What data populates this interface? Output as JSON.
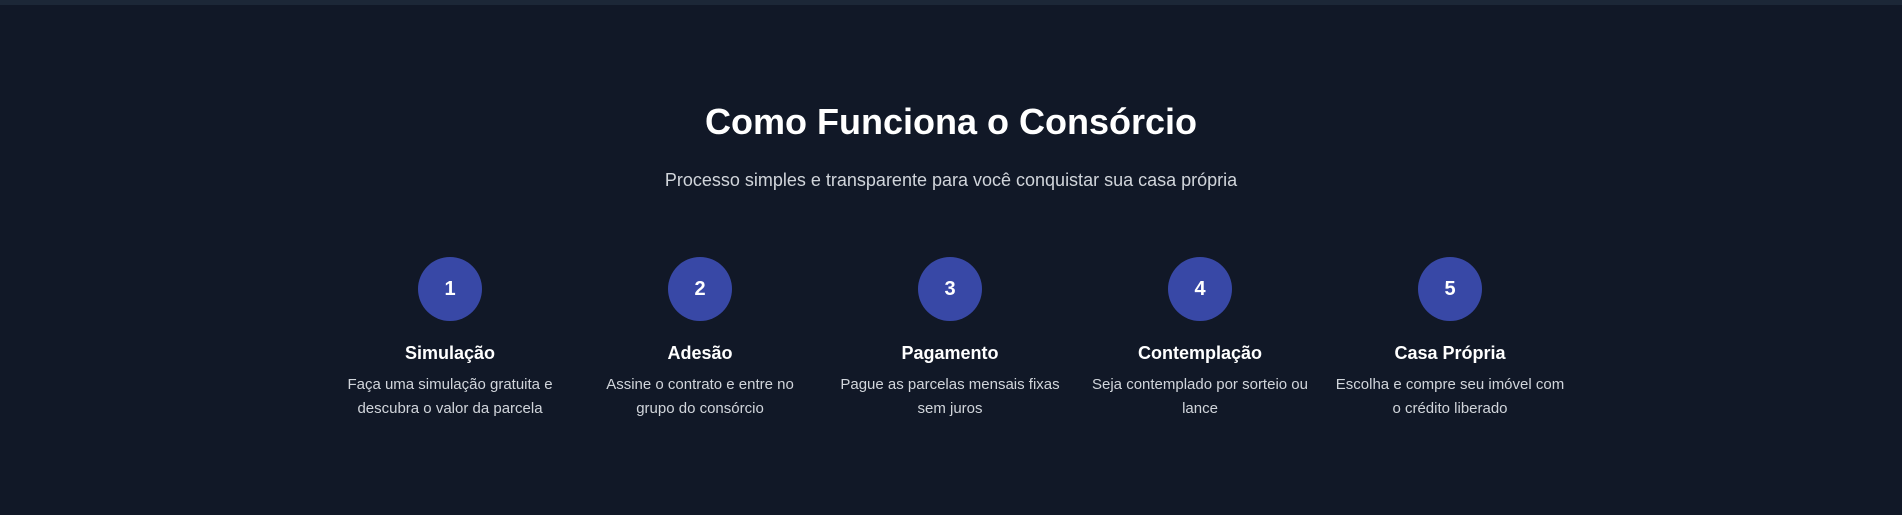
{
  "section": {
    "title": "Como Funciona o Consórcio",
    "subtitle": "Processo simples e transparente para você conquistar sua casa própria"
  },
  "steps": [
    {
      "number": "1",
      "title": "Simulação",
      "description": "Faça uma simulação gratuita e descubra o valor da parcela"
    },
    {
      "number": "2",
      "title": "Adesão",
      "description": "Assine o contrato e entre no grupo do consórcio"
    },
    {
      "number": "3",
      "title": "Pagamento",
      "description": "Pague as parcelas mensais fixas sem juros"
    },
    {
      "number": "4",
      "title": "Contemplação",
      "description": "Seja contemplado por sorteio ou lance"
    },
    {
      "number": "5",
      "title": "Casa Própria",
      "description": "Escolha e compre seu imóvel com o crédito liberado"
    }
  ],
  "colors": {
    "background": "#111827",
    "circle": "#3848a6",
    "text_primary": "#ffffff",
    "text_secondary": "#d1d5db"
  }
}
